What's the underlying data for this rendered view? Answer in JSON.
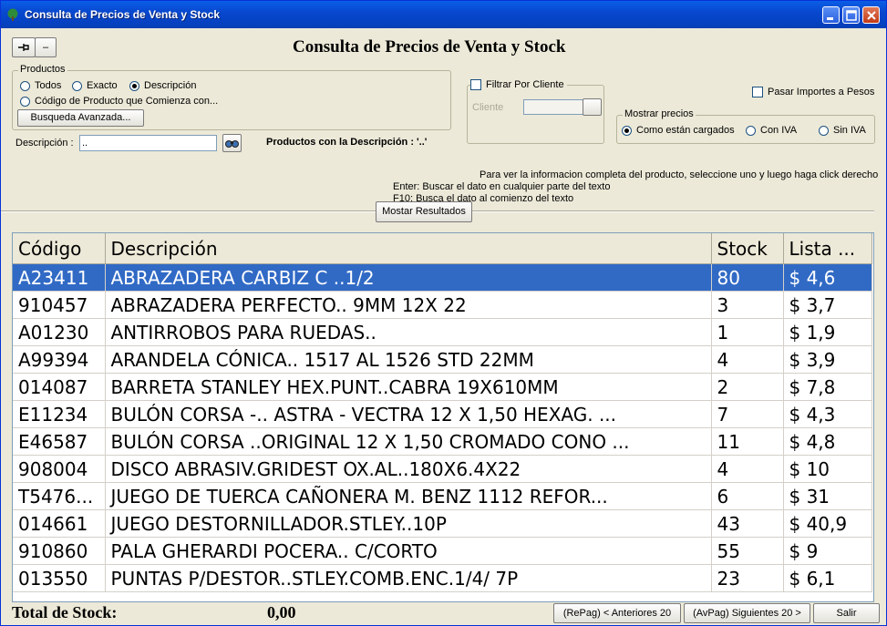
{
  "window": {
    "title": "Consulta de Precios de Venta y Stock",
    "app_icon": "tree-icon",
    "controls": [
      "minimize-icon",
      "maximize-icon",
      "close-icon"
    ]
  },
  "toolbar": {
    "pin_icon": "pin-icon",
    "minus_label": "–"
  },
  "heading": "Consulta de Precios de Venta y Stock",
  "productos": {
    "label": "Productos",
    "options": [
      "Todos",
      "Exacto",
      "Descripción",
      "Código de Producto que Comienza con..."
    ],
    "selected": "Descripción",
    "advanced_button": "Busqueda Avanzada..."
  },
  "filtro_cliente": {
    "label": "Filtrar Por Cliente",
    "checked": false,
    "cliente_label": "Cliente",
    "cliente_value": ""
  },
  "pasar_importes": {
    "label": "Pasar Importes a Pesos",
    "checked": false
  },
  "mostrar_precios": {
    "label": "Mostrar precios",
    "options": [
      "Como están cargados",
      "Con IVA",
      "Sin IVA"
    ],
    "selected": "Como están cargados"
  },
  "descripcion": {
    "label": "Descripción :",
    "value": "..",
    "search_icon": "binoculars-icon",
    "result_text": "Productos con la Descripción : '..'"
  },
  "help": {
    "line1": "Para ver la informacion completa del producto, seleccione uno y luego haga click derecho",
    "line2": "Enter: Buscar el dato en cualquier parte del texto",
    "line3": "F10: Busca el dato al comienzo del texto"
  },
  "show_results_button": "Mostar Resultados",
  "table": {
    "columns": [
      "Código",
      "Descripción",
      "Stock",
      "Lista ..."
    ],
    "selected_index": 0,
    "rows": [
      {
        "codigo": "A23411",
        "descripcion": "ABRAZADERA CARBIZ C ..1/2",
        "stock": "80",
        "lista": "$ 4,6"
      },
      {
        "codigo": "910457",
        "descripcion": "ABRAZADERA PERFECTO.. 9MM  12X 22",
        "stock": "3",
        "lista": "$ 3,7"
      },
      {
        "codigo": "A01230",
        "descripcion": "ANTIRROBOS PARA RUEDAS..",
        "stock": "1",
        "lista": "$ 1,9"
      },
      {
        "codigo": "A99394",
        "descripcion": "ARANDELA CÓNICA.. 1517 AL 1526 STD 22MM",
        "stock": "4",
        "lista": "$ 3,9"
      },
      {
        "codigo": "014087",
        "descripcion": "BARRETA STANLEY HEX.PUNT..CABRA 19X610MM",
        "stock": "2",
        "lista": "$ 7,8"
      },
      {
        "codigo": "E11234",
        "descripcion": "BULÓN CORSA -.. ASTRA - VECTRA   12 X 1,50  HEXAG. ...",
        "stock": "7",
        "lista": "$ 4,3"
      },
      {
        "codigo": "E46587",
        "descripcion": "BULÓN CORSA ..ORIGINAL 12 X 1,50 CROMADO CONO ...",
        "stock": "11",
        "lista": "$ 4,8"
      },
      {
        "codigo": "908004",
        "descripcion": "DISCO ABRASIV.GRIDEST OX.AL..180X6.4X22",
        "stock": "4",
        "lista": "$ 10"
      },
      {
        "codigo": "T5476...",
        "descripcion": "JUEGO DE TUERCA CAÑONERA M. BENZ 1112 REFOR...",
        "stock": "6",
        "lista": "$ 31"
      },
      {
        "codigo": "014661",
        "descripcion": "JUEGO DESTORNILLADOR.STLEY..10P",
        "stock": "43",
        "lista": "$ 40,9"
      },
      {
        "codigo": "910860",
        "descripcion": "PALA GHERARDI POCERA..   C/CORTO",
        "stock": "55",
        "lista": "$ 9"
      },
      {
        "codigo": "013550",
        "descripcion": "PUNTAS P/DESTOR..STLEY.COMB.ENC.1/4/ 7P",
        "stock": "23",
        "lista": "$ 6,1"
      }
    ]
  },
  "footer": {
    "total_label": "Total de Stock:",
    "total_value": "0,00",
    "prev_button": "(RePag) < Anteriores 20",
    "next_button": "(AvPag) Siguientes 20 >",
    "exit_button": "Salir"
  },
  "colors": {
    "titlebar": "#0548c9",
    "selection": "#316ac5",
    "face": "#ece9d8"
  }
}
